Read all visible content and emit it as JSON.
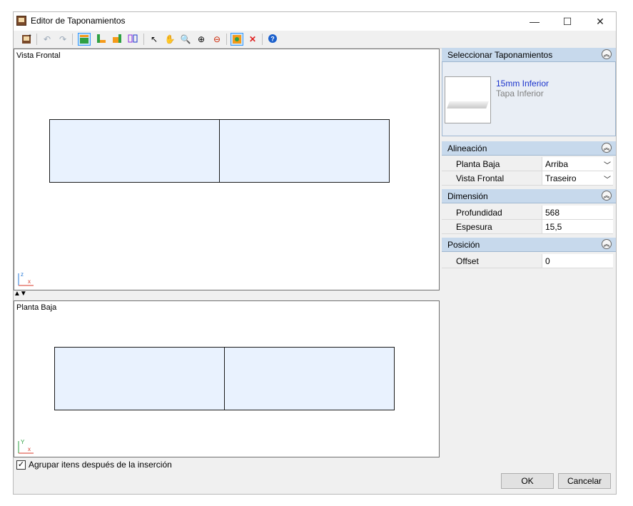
{
  "window": {
    "title": "Editor de Taponamientos",
    "controls": {
      "minimize": "—",
      "maximize": "☐",
      "close": "✕"
    }
  },
  "toolbar": {
    "icons": [
      "insert-icon",
      "undo-icon",
      "redo-icon",
      "align-top-icon",
      "align-bottom-icon",
      "align-left-icon",
      "split-icon",
      "pointer-icon",
      "pan-icon",
      "zoom-in-icon",
      "zoom-window-icon",
      "zoom-out-icon",
      "select-color-icon",
      "delete-icon",
      "help-icon"
    ]
  },
  "views": {
    "front": {
      "label": "Vista Frontal",
      "axis_up": "z",
      "axis_right": "x"
    },
    "top": {
      "label": "Planta Baja",
      "axis_up": "Y",
      "axis_right": "x"
    },
    "splitter": "▲▼"
  },
  "select_section": {
    "title": "Seleccionar Taponamientos",
    "item": {
      "name": "15mm Inferior",
      "subtitle": "Tapa Inferior"
    }
  },
  "alineacion": {
    "title": "Alineación",
    "rows": [
      {
        "label": "Planta Baja",
        "value": "Arriba"
      },
      {
        "label": "Vista Frontal",
        "value": "Traseiro"
      }
    ]
  },
  "dimension": {
    "title": "Dimensión",
    "rows": [
      {
        "label": "Profundidad",
        "value": "568"
      },
      {
        "label": "Espesura",
        "value": "15,5"
      }
    ]
  },
  "posicion": {
    "title": "Posición",
    "rows": [
      {
        "label": "Offset",
        "value": "0"
      }
    ]
  },
  "group_checkbox": {
    "label": "Agrupar itens después de la inserción",
    "checked": true
  },
  "buttons": {
    "ok": "OK",
    "cancel": "Cancelar"
  },
  "colors": {
    "accent": "#3399ff",
    "panel_fill": "#e9f2fe",
    "section_header": "#c7d9ec",
    "link": "#1a33cc"
  }
}
